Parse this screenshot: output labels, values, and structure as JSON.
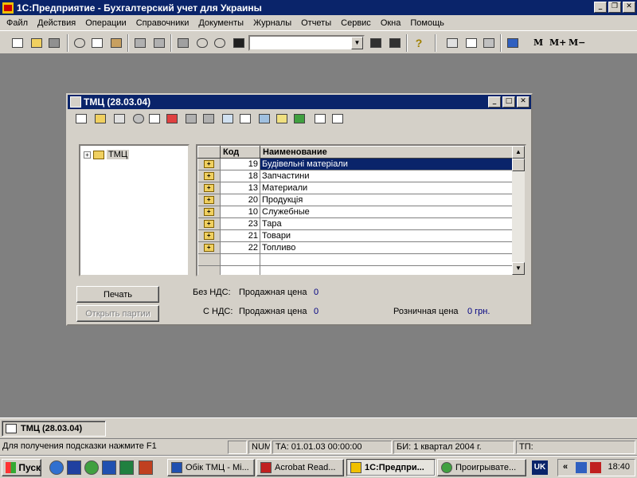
{
  "app": {
    "title": "1С:Предприятие - Бухгалтерский учет для Украины",
    "caption_min": "_",
    "caption_max": "❐",
    "caption_close": "✕"
  },
  "menu": [
    "Файл",
    "Действия",
    "Операции",
    "Справочники",
    "Документы",
    "Журналы",
    "Отчеты",
    "Сервис",
    "Окна",
    "Помощь"
  ],
  "toolbar": {
    "combo_value": "",
    "combo_arrow": "▼",
    "help_glyph": "?",
    "mem_buttons": [
      "M",
      "M+",
      "M−"
    ]
  },
  "window": {
    "title": "ТМЦ (28.03.04)",
    "caption_min": "_",
    "caption_max": "□",
    "caption_close": "✕",
    "tree_expander": "+",
    "tree_root": "ТМЦ",
    "grid": {
      "columns": [
        "",
        "Код",
        "Наименование"
      ],
      "rows": [
        {
          "code": "19",
          "name": "Будівельні матеріали"
        },
        {
          "code": "18",
          "name": "Запчастини"
        },
        {
          "code": "13",
          "name": "Материали"
        },
        {
          "code": "20",
          "name": "Продукція"
        },
        {
          "code": "10",
          "name": "Служебные"
        },
        {
          "code": "23",
          "name": "Тара"
        },
        {
          "code": "21",
          "name": "Товари"
        },
        {
          "code": "22",
          "name": "Топливо"
        }
      ],
      "folder_mark": "+",
      "scroll_up": "▲",
      "scroll_down": "▼"
    },
    "print_button": "Печать",
    "open_batches_button": "Открыть партии",
    "no_vat_label": "Без НДС:",
    "with_vat_label": "С НДС:",
    "sale_price_label": "Продажная цена",
    "sale_price_no_vat": "0",
    "sale_price_with_vat": "0",
    "retail_price_label": "Розничная цена",
    "retail_price_value": "0 грн."
  },
  "mdi_tab": "ТМЦ (28.03.04)",
  "status": {
    "hint": "Для получения подсказки нажмите F1",
    "num": "NUM",
    "ta": "ТА: 01.01.03  00:00:00",
    "bi": "БИ: 1 квартал 2004 г.",
    "tp": "ТП:"
  },
  "taskbar": {
    "start": "Пуск",
    "tasks": [
      "Обік ТМЦ - Mi...",
      "Acrobat Read...",
      "1С:Предпри...",
      "Проигрывате..."
    ],
    "lang": "UK",
    "tray_chevron": "«",
    "clock": "18:40"
  },
  "colors": {
    "title_bar": "#0a246a",
    "face": "#d4d0c8",
    "desktop": "#808080",
    "value_text": "#000080"
  }
}
